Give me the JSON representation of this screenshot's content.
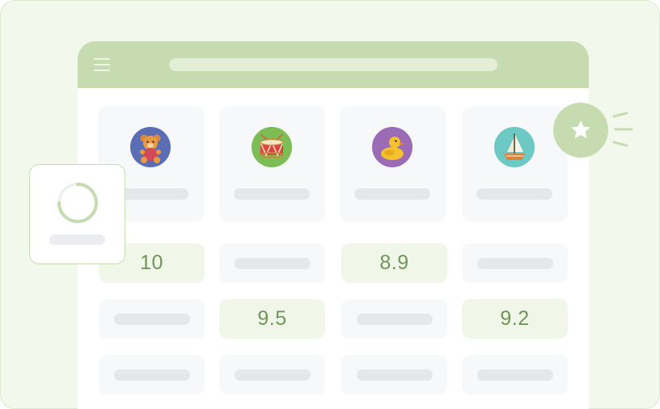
{
  "colors": {
    "accent": "#c6dcb0",
    "score_text": "#6f965a",
    "highlight_cell": "#f0f7e9",
    "placeholder": "#e6e7ea"
  },
  "toys": [
    {
      "icon": "teddy-bear-icon",
      "bg": "#5b6db5"
    },
    {
      "icon": "drum-icon",
      "bg": "#7cbd55"
    },
    {
      "icon": "rubber-duck-icon",
      "bg": "#9b6bb6"
    },
    {
      "icon": "sailboat-icon",
      "bg": "#6cc9c3"
    }
  ],
  "scores": {
    "r1c1": "10",
    "r1c3": "8.9",
    "r2c2": "9.5",
    "r2c4": "9.2"
  },
  "loading_progress": 0.75,
  "favorite_icon": "star-icon"
}
